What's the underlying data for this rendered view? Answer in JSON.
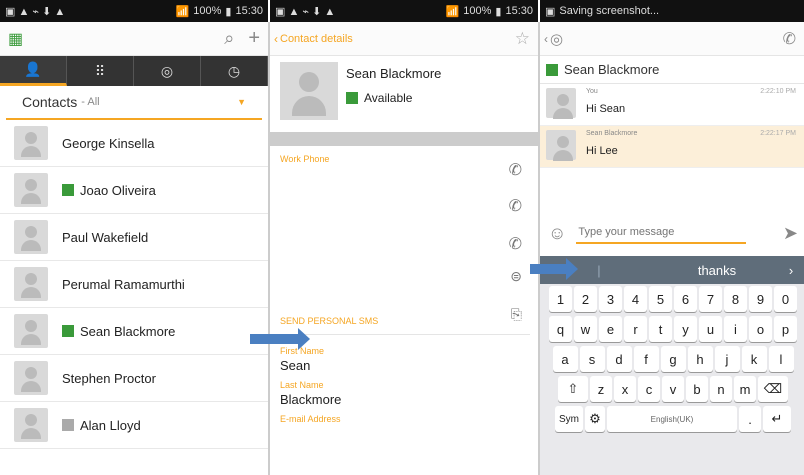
{
  "status1": {
    "time": "15:30",
    "battery": "100%"
  },
  "status2": {
    "time": "15:30",
    "battery": "100%"
  },
  "status3": {
    "text": "Saving screenshot..."
  },
  "contacts": {
    "header": "Contacts",
    "filter": "- All",
    "items": [
      {
        "name": "George Kinsella",
        "presence": "none"
      },
      {
        "name": "Joao Oliveira",
        "presence": "available"
      },
      {
        "name": "Paul Wakefield",
        "presence": "none"
      },
      {
        "name": "Perumal Ramamurthi",
        "presence": "none"
      },
      {
        "name": "Sean Blackmore",
        "presence": "available"
      },
      {
        "name": "Stephen Proctor",
        "presence": "none"
      },
      {
        "name": "Alan Lloyd",
        "presence": "offline"
      }
    ]
  },
  "details": {
    "back_label": "Contact details",
    "name": "Sean Blackmore",
    "status": "Available",
    "work_phone_label": "Work Phone",
    "sms_label": "SEND PERSONAL SMS",
    "first_name_label": "First Name",
    "first_name": "Sean",
    "last_name_label": "Last Name",
    "last_name": "Blackmore",
    "email_label": "E-mail Address"
  },
  "chat": {
    "contact": "Sean Blackmore",
    "messages": [
      {
        "sender": "You",
        "time": "2:22:10 PM",
        "text": "Hi Sean"
      },
      {
        "sender": "Sean Blackmore",
        "time": "2:22:17 PM",
        "text": "Hi Lee"
      }
    ],
    "input_placeholder": "Type your message",
    "suggestion": "thanks",
    "keyboard": {
      "row1": [
        "1",
        "2",
        "3",
        "4",
        "5",
        "6",
        "7",
        "8",
        "9",
        "0"
      ],
      "row2": [
        "q",
        "w",
        "e",
        "r",
        "t",
        "y",
        "u",
        "i",
        "o",
        "p"
      ],
      "row3": [
        "a",
        "s",
        "d",
        "f",
        "g",
        "h",
        "j",
        "k",
        "l"
      ],
      "row4": [
        "z",
        "x",
        "c",
        "v",
        "b",
        "n",
        "m"
      ],
      "sym": "Sym",
      "lang": "English(UK)"
    }
  }
}
